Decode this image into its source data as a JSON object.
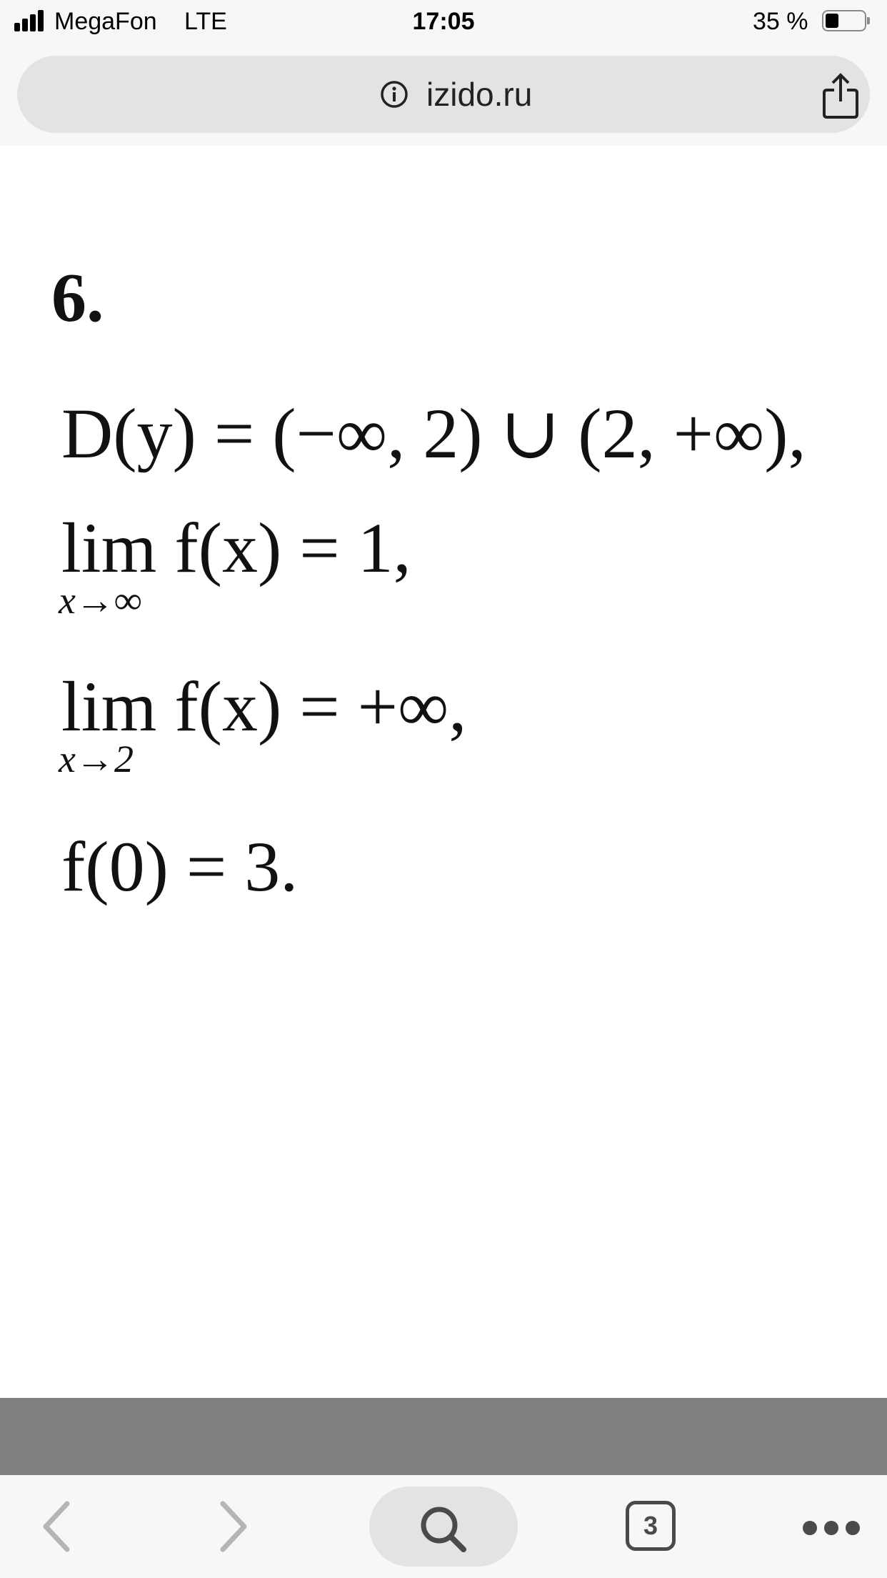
{
  "status_bar": {
    "carrier": "MegaFon",
    "network": "LTE",
    "time": "17:05",
    "battery_percent": "35 %",
    "battery_level": 0.35
  },
  "browser": {
    "url": "izido.ru",
    "icons": [
      "info-icon",
      "share-icon"
    ]
  },
  "content": {
    "problem_number": "6.",
    "lines": [
      "D(y) = (−∞, 2) ∪ (2, +∞),",
      "lim f(x) = 1,",
      "x→∞",
      "lim f(x) = +∞,",
      "x→2",
      "f(0) = 3."
    ]
  },
  "toolbar": {
    "tabs_count": "3",
    "icons": [
      "back-icon",
      "forward-icon",
      "search-icon",
      "tabs-icon",
      "more-icon"
    ]
  }
}
